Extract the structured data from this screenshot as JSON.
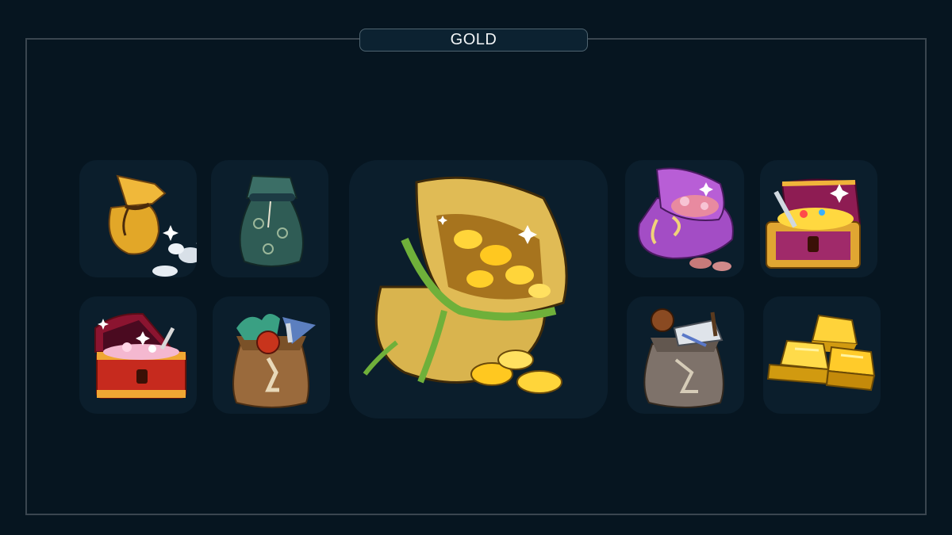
{
  "header": {
    "title": "GOLD"
  },
  "items": [
    {
      "icon": "small-gold-pouch-with-silver-coins-icon"
    },
    {
      "icon": "green-patterned-cloth-pouch-icon"
    },
    {
      "icon": "red-treasure-chest-with-gems-icon"
    },
    {
      "icon": "brown-sack-with-herbs-and-orb-icon"
    },
    {
      "icon": "large-gold-coin-sack-icon"
    },
    {
      "icon": "purple-pouch-with-red-coins-icon"
    },
    {
      "icon": "gold-treasure-chest-with-sword-icon"
    },
    {
      "icon": "grey-sack-with-weapons-icon"
    },
    {
      "icon": "gold-bars-stack-icon"
    }
  ],
  "colors": {
    "background": "#061520",
    "tile": "#0b1e2c",
    "frame": "#3a4650",
    "gold": "#f2c230"
  }
}
